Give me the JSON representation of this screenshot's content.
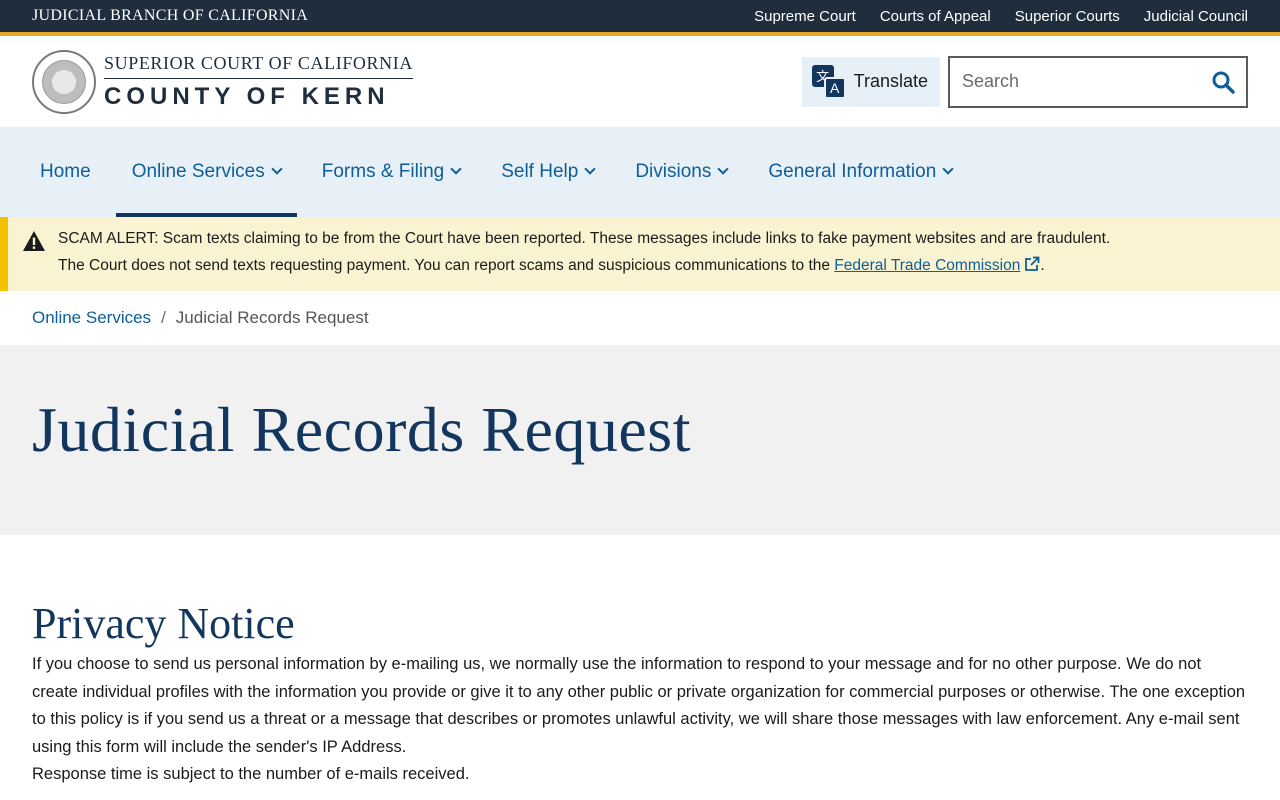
{
  "topbar": {
    "brand": "Judicial Branch of California",
    "links": [
      "Supreme Court",
      "Courts of Appeal",
      "Superior Courts",
      "Judicial Council"
    ]
  },
  "header": {
    "logo_line1": "Superior Court of California",
    "logo_line2": "County of Kern",
    "translate_label": "Translate",
    "search_placeholder": "Search",
    "search_value": ""
  },
  "nav": {
    "items": [
      {
        "label": "Home",
        "has_dropdown": false
      },
      {
        "label": "Online Services",
        "has_dropdown": true,
        "active": true
      },
      {
        "label": "Forms & Filing",
        "has_dropdown": true
      },
      {
        "label": "Self Help",
        "has_dropdown": true
      },
      {
        "label": "Divisions",
        "has_dropdown": true
      },
      {
        "label": "General Information",
        "has_dropdown": true
      }
    ]
  },
  "alert": {
    "icon": "warning-icon",
    "line1": "SCAM ALERT: Scam texts claiming to be from the Court have been reported. These messages include links to fake payment websites and are fraudulent.",
    "line2_prefix": "The Court does not send texts requesting payment. You can report scams and suspicious communications to the ",
    "link_text": "Federal Trade Commission",
    "line2_suffix": "."
  },
  "breadcrumb": {
    "parent": "Online Services",
    "separator": "/",
    "current": "Judicial Records Request"
  },
  "page": {
    "title": "Judicial Records Request"
  },
  "content": {
    "heading": "Privacy Notice",
    "paragraph1": "If you choose to send us personal information by e-mailing us, we normally use the information to respond to your message and for no other purpose. We do not create individual profiles with the information you provide or give it to any other public or private organization for commercial purposes or otherwise. The one exception to this policy is if you send us a threat or a message that describes or promotes unlawful activity, we will share those messages with law enforcement. Any e-mail sent using this form will include the sender's IP Address.",
    "paragraph2": "Response time is subject to the number of e-mails received."
  },
  "colors": {
    "topbar_bg": "#1f2d3d",
    "topbar_accent": "#e8a828",
    "nav_bg": "#e8f0f7",
    "link": "#0e5e9a",
    "heading": "#12365d",
    "alert_bg": "#faf3d1",
    "alert_border": "#f2c200",
    "title_band_bg": "#f1f1f1"
  }
}
